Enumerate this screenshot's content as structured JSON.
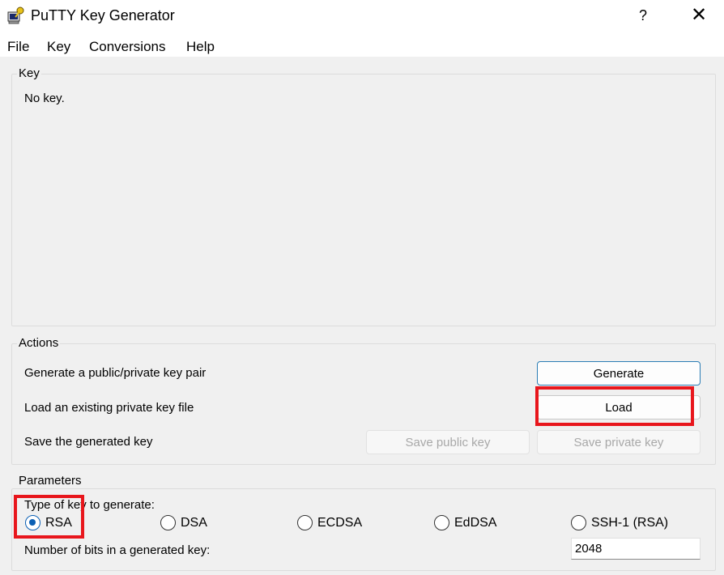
{
  "window": {
    "title": "PuTTY Key Generator",
    "help_glyph": "?",
    "close_glyph": "✕"
  },
  "menu": [
    "File",
    "Key",
    "Conversions",
    "Help"
  ],
  "key_group": {
    "title": "Key",
    "status": "No key."
  },
  "actions": {
    "title": "Actions",
    "generate_label": "Generate a public/private key pair",
    "generate_button": "Generate",
    "load_label": "Load an existing private key file",
    "load_button": "Load",
    "save_label": "Save the generated key",
    "save_public_button": "Save public key",
    "save_private_button": "Save private key"
  },
  "parameters": {
    "title": "Parameters",
    "type_label": "Type of key to generate:",
    "types": [
      {
        "label": "RSA",
        "checked": true
      },
      {
        "label": "DSA",
        "checked": false
      },
      {
        "label": "ECDSA",
        "checked": false
      },
      {
        "label": "EdDSA",
        "checked": false
      },
      {
        "label": "SSH-1 (RSA)",
        "checked": false
      }
    ],
    "bits_label": "Number of bits in a generated key:",
    "bits_value": "2048"
  },
  "colors": {
    "highlight": "#e8161c",
    "accent": "#0a5fb4"
  }
}
